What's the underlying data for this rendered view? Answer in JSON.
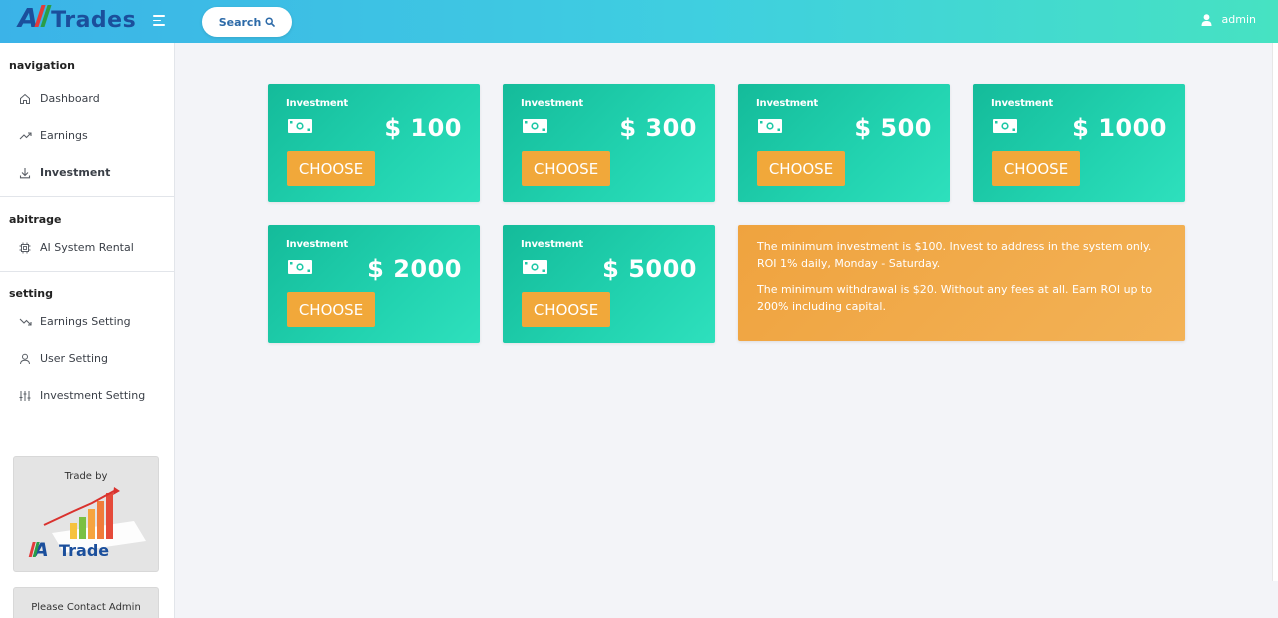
{
  "header": {
    "logo_all": "All",
    "logo_trades": "Trades",
    "search_label": "Search",
    "user_name": "admin"
  },
  "sidebar": {
    "sections": [
      {
        "title": "navigation",
        "items": [
          {
            "label": "Dashboard",
            "icon": "home-icon"
          },
          {
            "label": "Earnings",
            "icon": "trending-up-icon"
          },
          {
            "label": "Investment",
            "icon": "download-icon"
          }
        ]
      },
      {
        "title": "abitrage",
        "items": [
          {
            "label": "AI System Rental",
            "icon": "cpu-icon"
          }
        ]
      },
      {
        "title": "setting",
        "items": [
          {
            "label": "Earnings Setting",
            "icon": "trending-down-icon"
          },
          {
            "label": "User Setting",
            "icon": "user-icon"
          },
          {
            "label": "Investment Setting",
            "icon": "sliders-icon"
          }
        ]
      }
    ],
    "promo": {
      "title": "Trade by",
      "brand_all": "All",
      "brand_trade": "Trade"
    },
    "contact": "Please Contact Admin"
  },
  "cards": [
    {
      "label": "Investment",
      "amount": "$ 100",
      "button": "CHOOSE"
    },
    {
      "label": "Investment",
      "amount": "$ 300",
      "button": "CHOOSE"
    },
    {
      "label": "Investment",
      "amount": "$ 500",
      "button": "CHOOSE"
    },
    {
      "label": "Investment",
      "amount": "$ 1000",
      "button": "CHOOSE"
    },
    {
      "label": "Investment",
      "amount": "$ 2000",
      "button": "CHOOSE"
    },
    {
      "label": "Investment",
      "amount": "$ 5000",
      "button": "CHOOSE"
    }
  ],
  "info": {
    "line1": "The minimum investment is $100. Invest to address in the system only. ROI 1% daily, Monday - Saturday.",
    "line2": "The minimum withdrawal is $20. Without any fees at all. Earn ROI up to 200% including capital."
  },
  "colors": {
    "header_gradient_start": "#3bb3e8",
    "header_gradient_end": "#46e2c2",
    "card_teal": "#1ec8a6",
    "button_orange": "#f1a83a",
    "info_orange": "#efa33f"
  }
}
